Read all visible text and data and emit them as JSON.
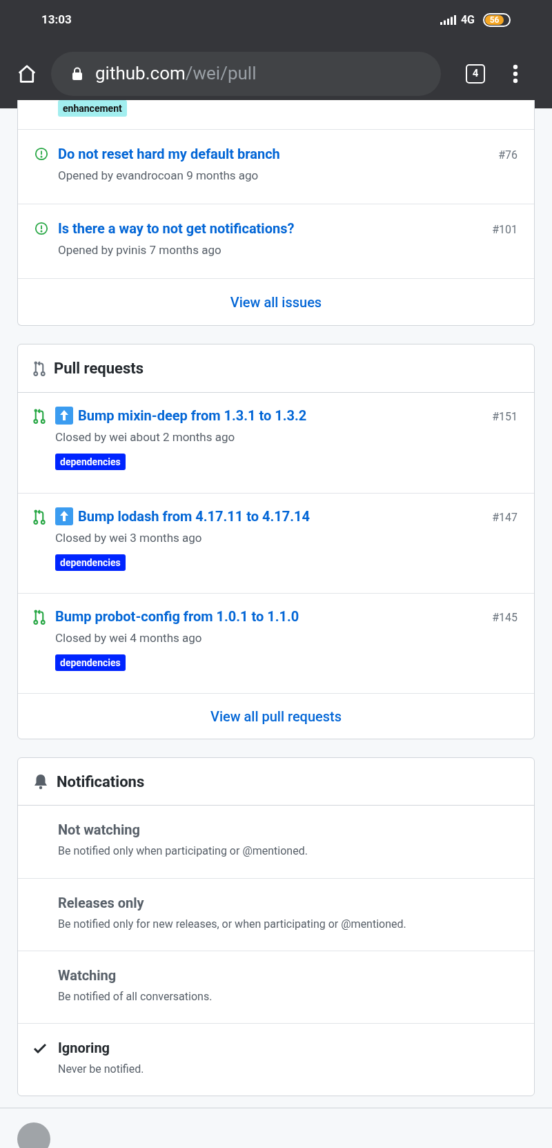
{
  "status_bar": {
    "time": "13:03",
    "network": "4G",
    "battery": "56"
  },
  "browser": {
    "url_host": "github.com",
    "url_path": "/wei/pull",
    "tab_count": "4"
  },
  "issues": {
    "top_label": {
      "text": "enhancement",
      "color": "#a2eeef"
    },
    "items": [
      {
        "title": "Do not reset hard my default branch",
        "meta": "Opened by evandrocoan 9 months ago",
        "number": "#76"
      },
      {
        "title": "Is there a way to not get notifications?",
        "meta": "Opened by pvinis 7 months ago",
        "number": "#101"
      }
    ],
    "view_all": "View all issues"
  },
  "pull_requests": {
    "title": "Pull requests",
    "items": [
      {
        "title": "Bump mixin-deep from 1.3.1 to 1.3.2",
        "kind": "arrow",
        "meta": "Closed by wei about 2 months ago",
        "number": "#151",
        "labels": [
          {
            "text": "dependencies",
            "color": "#0025ff"
          }
        ]
      },
      {
        "title": "Bump lodash from 4.17.11 to 4.17.14",
        "kind": "arrow",
        "meta": "Closed by wei 3 months ago",
        "number": "#147",
        "labels": [
          {
            "text": "dependencies",
            "color": "#0025ff"
          }
        ]
      },
      {
        "title": "Bump probot-config from 1.0.1 to 1.1.0",
        "kind": "plain",
        "meta": "Closed by wei 4 months ago",
        "number": "#145",
        "labels": [
          {
            "text": "dependencies",
            "color": "#0025ff"
          }
        ]
      }
    ],
    "view_all": "View all pull requests"
  },
  "notifications": {
    "title": "Notifications",
    "options": [
      {
        "title": "Not watching",
        "description": "Be notified only when participating or @mentioned.",
        "selected": false
      },
      {
        "title": "Releases only",
        "description": "Be notified only for new releases, or when participating or @mentioned.",
        "selected": false
      },
      {
        "title": "Watching",
        "description": "Be notified of all conversations.",
        "selected": false
      },
      {
        "title": "Ignoring",
        "description": "Never be notified.",
        "selected": true
      }
    ]
  }
}
